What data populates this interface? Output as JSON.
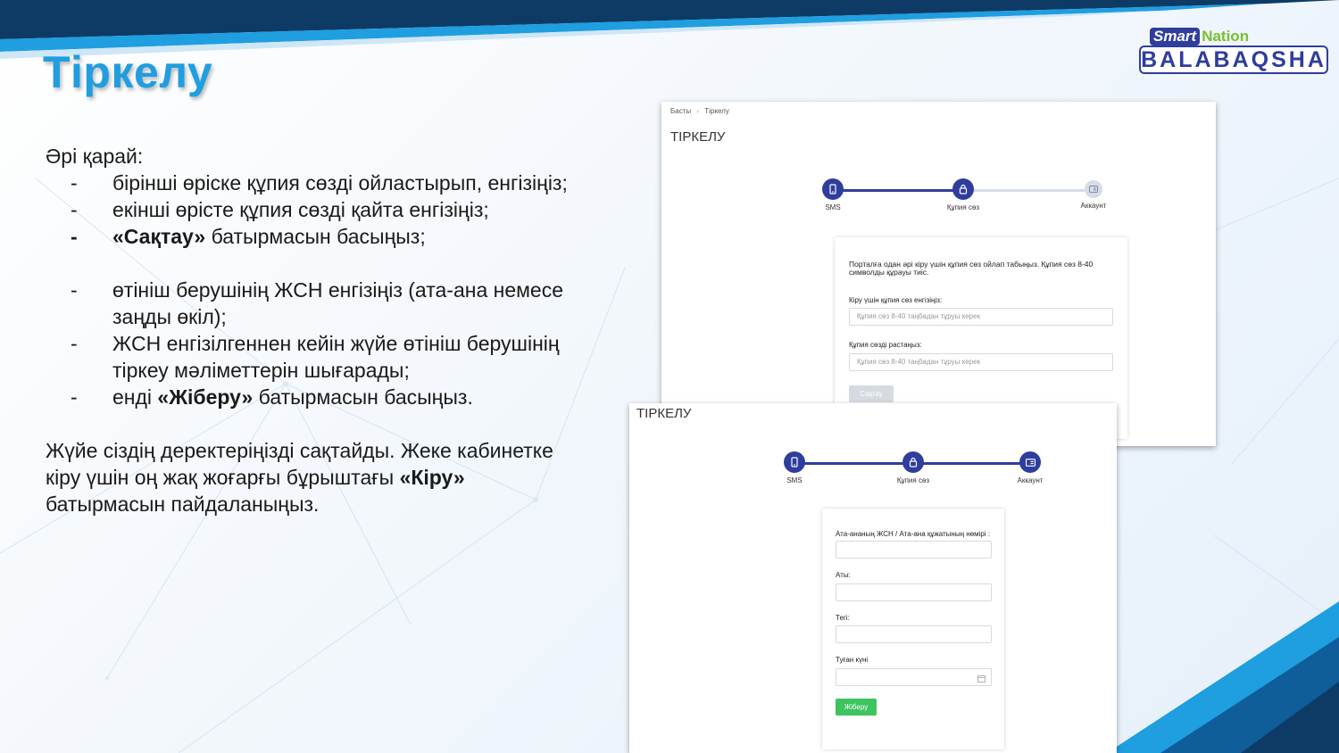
{
  "slide": {
    "title": "Тіркелу"
  },
  "logo": {
    "smart": "Smart",
    "nation": "Nation",
    "brand": "BALABAQSHA"
  },
  "instructions": {
    "intro": "Әрі қарай:",
    "steps": [
      "бірінші өріске құпия сөзді ойластырып, енгізіңіз;",
      "екінші өрісте құпия сөзді қайта енгізіңіз;",
      {
        "bold": "«Сақтау»",
        "rest": " батырмасын басыңыз;"
      },
      "өтініш берушінің ЖСН енгізіңіз (ата-ана немесе заңды өкіл);",
      "ЖСН енгізілгеннен кейін жүйе өтініш берушінің тіркеу мәліметтерін шығарады;",
      {
        "pre": "енді ",
        "bold": "«Жіберу»",
        "rest": " батырмасын басыңыз."
      }
    ],
    "dash": "-",
    "outro_text": "Жүйе сіздің деректеріңізді сақтайды. Жеке кабинетке кіру үшін оң жақ жоғарғы бұрыштағы ",
    "outro_bold": "«Кіру»",
    "outro_rest": " батырмасын пайдаланыңыз."
  },
  "screen1": {
    "breadcrumb": [
      "Басты",
      "›",
      "Тіркелу"
    ],
    "title": "ТІРКЕЛУ",
    "steps": [
      {
        "label": "SMS",
        "icon": "phone-icon",
        "state": "done"
      },
      {
        "label": "Құпия сөз",
        "icon": "lock-icon",
        "state": "active"
      },
      {
        "label": "Аккаунт",
        "icon": "id-card-icon",
        "state": "pending"
      }
    ],
    "description": "Порталға одан әрі кіру үшін құпия сөз ойлап табыңыз. Құпия сөз 8-40 символды құрауы тиіс.",
    "password_label": "Кіру үшін құпия сөз енгізіңіз:",
    "password_placeholder": "Құпия сөз 8-40 таңбадан тұруы керек",
    "confirm_label": "Құпия сөзді растаңыз:",
    "confirm_placeholder": "Құпия сөз 8-40 таңбадан тұруы керек",
    "save_button": "Сақтау"
  },
  "screen2": {
    "title": "ТІРКЕЛУ",
    "steps": [
      {
        "label": "SMS",
        "icon": "phone-icon",
        "state": "done"
      },
      {
        "label": "Құпия сөз",
        "icon": "lock-icon",
        "state": "done"
      },
      {
        "label": "Аккаунт",
        "icon": "id-card-icon",
        "state": "active"
      }
    ],
    "iin_label": "Ата-ананың ЖСН / Ата-ана құжатының нөмірі :",
    "name_label": "Аты:",
    "surname_label": "Тегі:",
    "birthdate_label": "Туған күні",
    "send_button": "Жіберу"
  },
  "colors": {
    "title_blue": "#1f9ee0",
    "brand_navy": "#2f3d9c",
    "brand_green": "#7bbf2c",
    "send_green": "#3ec45e"
  }
}
